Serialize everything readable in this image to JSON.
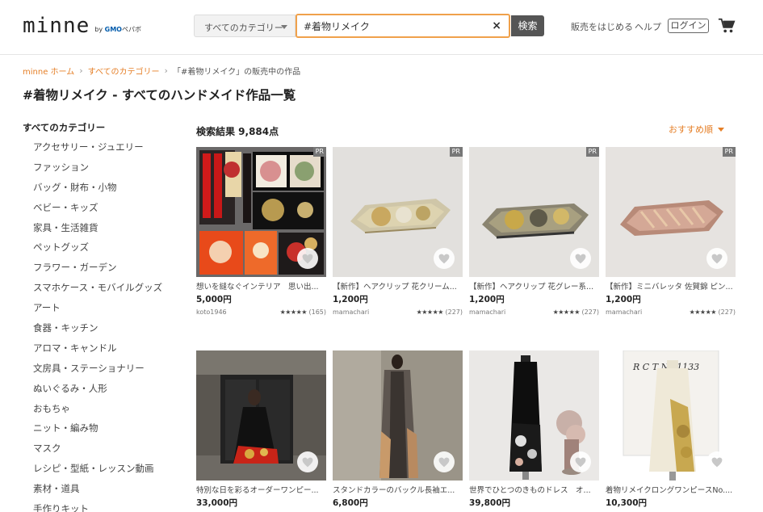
{
  "header": {
    "logo": "minne",
    "logo_sub_by": "by",
    "logo_sub_brand": "GMO",
    "logo_sub_name": "ペパボ",
    "category_select": "すべてのカテゴリー",
    "search_value": "#着物リメイク",
    "search_clear": "×",
    "search_button": "検索",
    "nav_sell": "販売をはじめる",
    "nav_help": "ヘルプ",
    "login": "ログイン"
  },
  "breadcrumb": {
    "home": "minne ホーム",
    "all_categories": "すべてのカテゴリー",
    "current": "「#着物リメイク」の販売中の作品"
  },
  "page_title": "#着物リメイク - すべてのハンドメイド作品一覧",
  "sidebar": {
    "heading": "すべてのカテゴリー",
    "items": [
      "アクセサリー・ジュエリー",
      "ファッション",
      "バッグ・財布・小物",
      "ベビー・キッズ",
      "家具・生活雑貨",
      "ペットグッズ",
      "フラワー・ガーデン",
      "スマホケース・モバイルグッズ",
      "アート",
      "食器・キッチン",
      "アロマ・キャンドル",
      "文房具・ステーショナリー",
      "ぬいぐるみ・人形",
      "おもちゃ",
      "ニット・編み物",
      "マスク",
      "レシピ・型紙・レッスン動画",
      "素材・道具",
      "手作りキット"
    ]
  },
  "results": {
    "count": "検索結果 9,884点",
    "sort": "おすすめ順"
  },
  "products": [
    {
      "title": "想いを縫なぐインテリア　思い出...",
      "price": "5,000円",
      "seller": "koto1946",
      "reviews": "(165)",
      "pr": "PR"
    },
    {
      "title": "【新作】ヘアクリップ 花クリーム...",
      "price": "1,200円",
      "seller": "mamachari",
      "reviews": "(227)",
      "pr": "PR"
    },
    {
      "title": "【新作】ヘアクリップ 花グレー系...",
      "price": "1,200円",
      "seller": "mamachari",
      "reviews": "(227)",
      "pr": "PR"
    },
    {
      "title": "【新作】ミニバレッタ 佐賀錦 ピン...",
      "price": "1,200円",
      "seller": "mamachari",
      "reviews": "(227)",
      "pr": "PR"
    },
    {
      "title": "特別な日を彩るオーダーワンピー...",
      "price": "33,000円"
    },
    {
      "title": "スタンドカラーのバックル長袖エ...",
      "price": "6,800円"
    },
    {
      "title": "世界でひとつのきものドレス　オ...",
      "price": "39,800円"
    },
    {
      "title": "着物リメイクロングワンピースNo....",
      "price": "10,300円"
    }
  ],
  "rating_stars": "★★★★★",
  "product5_caption": "R C T No.1133"
}
